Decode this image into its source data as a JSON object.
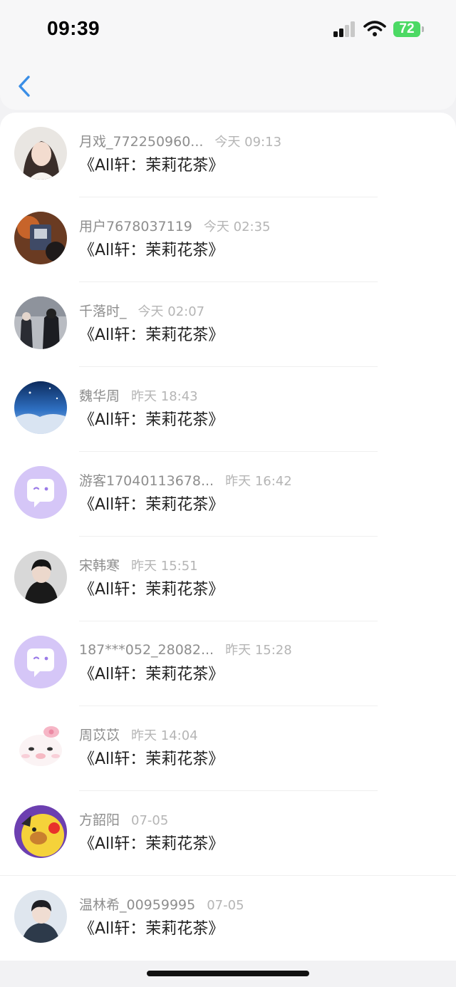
{
  "status_bar": {
    "time": "09:39",
    "battery": "72"
  },
  "nav": {
    "back_icon": "chevron-left-icon"
  },
  "items": [
    {
      "name": "月戏_772250960...",
      "time": "今天 09:13",
      "message": "《All轩：茉莉花茶》",
      "avatar": "photo-girl"
    },
    {
      "name": "用户7678037119",
      "time": "今天 02:35",
      "message": "《All轩：茉莉花茶》",
      "avatar": "photo-orange"
    },
    {
      "name": "千落时_",
      "time": "今天 02:07",
      "message": "《All轩：茉莉花茶》",
      "avatar": "photo-street"
    },
    {
      "name": "魏华周",
      "time": "昨天 18:43",
      "message": "《All轩：茉莉花茶》",
      "avatar": "photo-sky"
    },
    {
      "name": "游客17040113678...",
      "time": "昨天 16:42",
      "message": "《All轩：茉莉花茶》",
      "avatar": "default-chat-avatar"
    },
    {
      "name": "宋韩寒",
      "time": "昨天 15:51",
      "message": "《All轩：茉莉花茶》",
      "avatar": "photo-boy-dark"
    },
    {
      "name": "187***052_28082...",
      "time": "昨天 15:28",
      "message": "《All轩：茉莉花茶》",
      "avatar": "default-chat-avatar"
    },
    {
      "name": "周苡苡",
      "time": "昨天 14:04",
      "message": "《All轩：茉莉花茶》",
      "avatar": "cartoon-kitty"
    },
    {
      "name": "方韶阳",
      "time": "07-05",
      "message": "《All轩：茉莉花茶》",
      "avatar": "cartoon-yellow"
    },
    {
      "name": "温林希_00959995",
      "time": "07-05",
      "message": "《All轩：茉莉花茶》",
      "avatar": "photo-boy-light"
    }
  ],
  "colors": {
    "accent": "#3a8ee6",
    "battery": "#4cd964",
    "default_avatar_bg": "#d5c6f7",
    "default_avatar_fg": "#9b7be8"
  }
}
